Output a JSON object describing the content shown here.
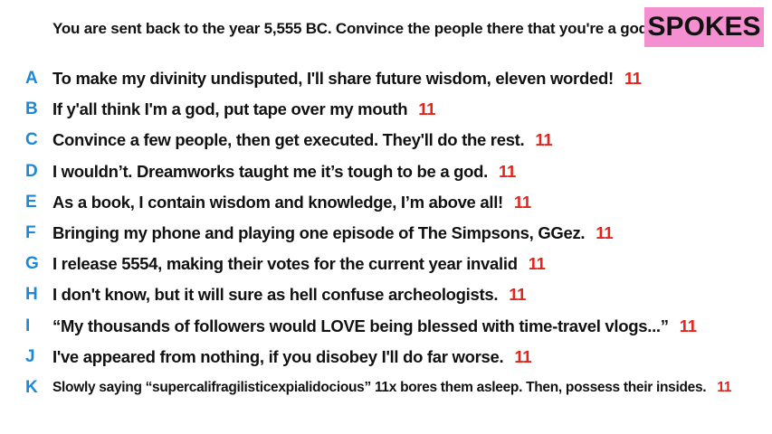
{
  "prompt": "You are sent back to the year 5,555 BC. Convince the people there that you're a god.",
  "logo": "SPOKES",
  "colors": {
    "logo_bg": "#f48fd0",
    "letter": "#1e88d6",
    "score": "#e3241b"
  },
  "answers": [
    {
      "letter": "A",
      "text": "To make my divinity undisputed, I'll share future wisdom, eleven worded!",
      "score": "11"
    },
    {
      "letter": "B",
      "text": "If y'all think I'm a god, put tape over my mouth",
      "score": "11"
    },
    {
      "letter": "C",
      "text": "Convince a few people, then get executed. They'll do the rest.",
      "score": "11"
    },
    {
      "letter": "D",
      "text": "I wouldn’t. Dreamworks taught me it’s tough to be a god.",
      "score": "11"
    },
    {
      "letter": "E",
      "text": "As a book, I contain wisdom and knowledge, I’m above all!",
      "score": "11"
    },
    {
      "letter": "F",
      "text": "Bringing my phone and playing one episode of The Simpsons, GGez.",
      "score": "11"
    },
    {
      "letter": "G",
      "text": "I release 5554, making their votes for the current year invalid",
      "score": "11"
    },
    {
      "letter": "H",
      "text": "I don't know, but it will sure as hell confuse archeologists.",
      "score": "11"
    },
    {
      "letter": "I",
      "text": "“My thousands of followers would LOVE being blessed with time-travel vlogs...”",
      "score": "11"
    },
    {
      "letter": "J",
      "text": "I've appeared from nothing, if you disobey I'll do far worse.",
      "score": "11"
    },
    {
      "letter": "K",
      "text": "Slowly saying “supercalifragilisticexpialidocious” 11x bores them asleep. Then, possess their insides.",
      "score": "11"
    }
  ]
}
